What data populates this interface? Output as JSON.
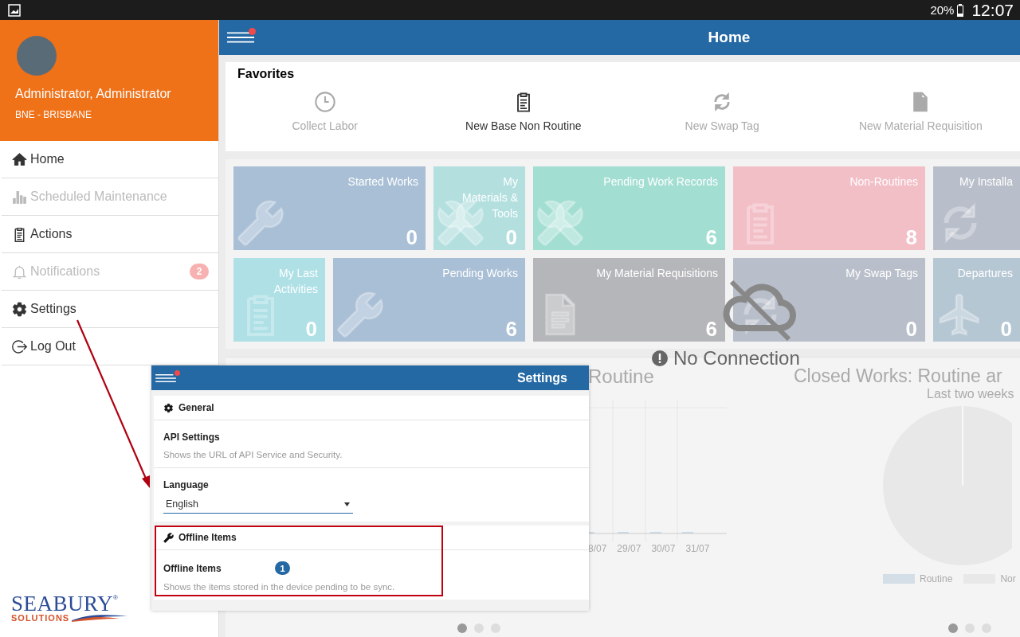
{
  "status_bar": {
    "battery": "20%",
    "time": "12:07"
  },
  "user": {
    "name": "Administrator, Administrator",
    "location": "BNE - BRISBANE"
  },
  "menu": [
    {
      "label": "Home",
      "disabled": false
    },
    {
      "label": "Scheduled Maintenance",
      "disabled": true
    },
    {
      "label": "Actions",
      "disabled": false
    },
    {
      "label": "Notifications",
      "disabled": true,
      "badge": "2"
    },
    {
      "label": "Settings",
      "disabled": false
    },
    {
      "label": "Log Out",
      "disabled": false
    }
  ],
  "logo": {
    "name": "SEABURY",
    "mark": "®",
    "tagline": "SOLUTIONS"
  },
  "top_bar": {
    "title": "Home",
    "alert": true
  },
  "favorites": {
    "title": "Favorites",
    "items": [
      {
        "label": "Collect Labor",
        "disabled": true
      },
      {
        "label": "New Base Non Routine",
        "disabled": false
      },
      {
        "label": "New Swap Tag",
        "disabled": true
      },
      {
        "label": "New Material Requisition",
        "disabled": true
      }
    ]
  },
  "tile_rows": [
    {
      "tiles": [
        {
          "label": "Started Works",
          "count": "0",
          "color": "#a9bfd6"
        },
        {
          "label": "My Materials & Tools",
          "count": "0",
          "color": "#b3dfdf"
        },
        {
          "label": "Pending Work Records",
          "count": "6",
          "color": "#a3ded3"
        },
        {
          "label": "Non-Routines",
          "count": "8",
          "color": "#f2bfc7"
        },
        {
          "label": "My Installa",
          "color": "#b9bfca"
        }
      ]
    },
    {
      "tiles": [
        {
          "label": "My Last Activities",
          "count": "0",
          "color": "#aee0e6"
        },
        {
          "label": "Pending Works",
          "count": "6",
          "color": "#a9bfd6"
        },
        {
          "label": "My Material Requisitions",
          "count": "6",
          "color": "#b5b6b9"
        },
        {
          "label": "My Swap Tags",
          "count": "0",
          "color": "#b9bfca"
        },
        {
          "label": "Departures",
          "count": "0",
          "color": "#b6c7d4"
        }
      ]
    }
  ],
  "connection": {
    "message": "No Connection"
  },
  "charts": [
    {
      "title": "Routine",
      "x_labels": [
        "8/07",
        "29/07",
        "30/07",
        "31/07"
      ],
      "pager": [
        {
          "selected": true
        },
        {
          "selected": false
        },
        {
          "selected": false
        }
      ]
    },
    {
      "title": "Closed Works: Routine ar",
      "subtitle": "Last two weeks",
      "legend": [
        {
          "label": "Routine",
          "color": "#d3dee6"
        },
        {
          "label": "Nor",
          "color": "#e8e8e8"
        }
      ],
      "pager": [
        {
          "selected": true
        },
        {
          "selected": false
        },
        {
          "selected": false
        }
      ]
    }
  ],
  "settings_panel": {
    "title": "Settings",
    "alert": true,
    "sections": [
      {
        "title": "General",
        "highlighted": false,
        "items": [
          {
            "kind": "info",
            "title": "API Settings",
            "description": "Shows the URL of API Service and Security."
          },
          {
            "kind": "select",
            "title": "Language",
            "value": "English"
          }
        ]
      },
      {
        "title": "Offline Items",
        "highlighted": true,
        "items": [
          {
            "kind": "info",
            "title": "Offline Items",
            "badge": "1",
            "description": "Shows the items stored in the device pending to be sync."
          }
        ]
      }
    ]
  }
}
